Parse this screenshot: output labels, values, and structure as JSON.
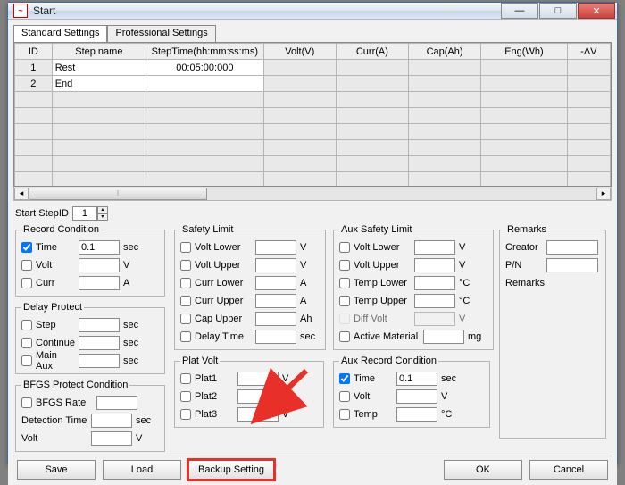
{
  "window": {
    "title": "Start"
  },
  "tabs": {
    "standard": "Standard Settings",
    "professional": "Professional Settings"
  },
  "grid": {
    "headers": [
      "ID",
      "Step name",
      "StepTime(hh:mm:ss:ms)",
      "Volt(V)",
      "Curr(A)",
      "Cap(Ah)",
      "Eng(Wh)",
      "-ΔV"
    ],
    "rows": [
      {
        "id": "1",
        "name": "Rest",
        "time": "00:05:00:000"
      },
      {
        "id": "2",
        "name": "End",
        "time": ""
      }
    ]
  },
  "start_step": {
    "label": "Start StepID",
    "value": "1"
  },
  "record": {
    "legend": "Record Condition",
    "time_lbl": "Time",
    "time_val": "0.1",
    "time_unit": "sec",
    "volt_lbl": "Volt",
    "volt_unit": "V",
    "curr_lbl": "Curr",
    "curr_unit": "A"
  },
  "delay": {
    "legend": "Delay Protect",
    "step_lbl": "Step",
    "step_unit": "sec",
    "cont_lbl": "Continue",
    "cont_unit": "sec",
    "main_lbl": "Main Aux",
    "main_unit": "sec"
  },
  "bfgs": {
    "legend": "BFGS Protect Condition",
    "rate_lbl": "BFGS Rate",
    "det_lbl": "Detection Time",
    "det_unit": "sec",
    "volt_lbl": "Volt",
    "volt_unit": "V"
  },
  "safety": {
    "legend": "Safety Limit",
    "vl_lbl": "Volt Lower",
    "v_unit": "V",
    "vu_lbl": "Volt Upper",
    "cl_lbl": "Curr Lower",
    "a_unit": "A",
    "cu_lbl": "Curr Upper",
    "capu_lbl": "Cap Upper",
    "ah_unit": "Ah",
    "dt_lbl": "Delay Time",
    "s_unit": "sec"
  },
  "plat": {
    "legend": "Plat Volt",
    "p1": "Plat1",
    "p2": "Plat2",
    "p3": "Plat3",
    "unit": "V"
  },
  "aux_safety": {
    "legend": "Aux Safety Limit",
    "vl": "Volt Lower",
    "vu": "Volt Upper",
    "tl": "Temp Lower",
    "tu": "Temp Upper",
    "dv": "Diff Volt",
    "v_unit": "V",
    "c_unit": "°C",
    "am_lbl": "Active Material",
    "am_unit": "mg"
  },
  "aux_record": {
    "legend": "Aux Record Condition",
    "time_lbl": "Time",
    "time_val": "0.1",
    "time_unit": "sec",
    "volt_lbl": "Volt",
    "v_unit": "V",
    "temp_lbl": "Temp",
    "c_unit": "°C"
  },
  "remarks": {
    "legend": "Remarks",
    "creator": "Creator",
    "pn": "P/N",
    "rem": "Remarks"
  },
  "buttons": {
    "save": "Save",
    "load": "Load",
    "backup": "Backup Setting",
    "ok": "OK",
    "cancel": "Cancel"
  }
}
